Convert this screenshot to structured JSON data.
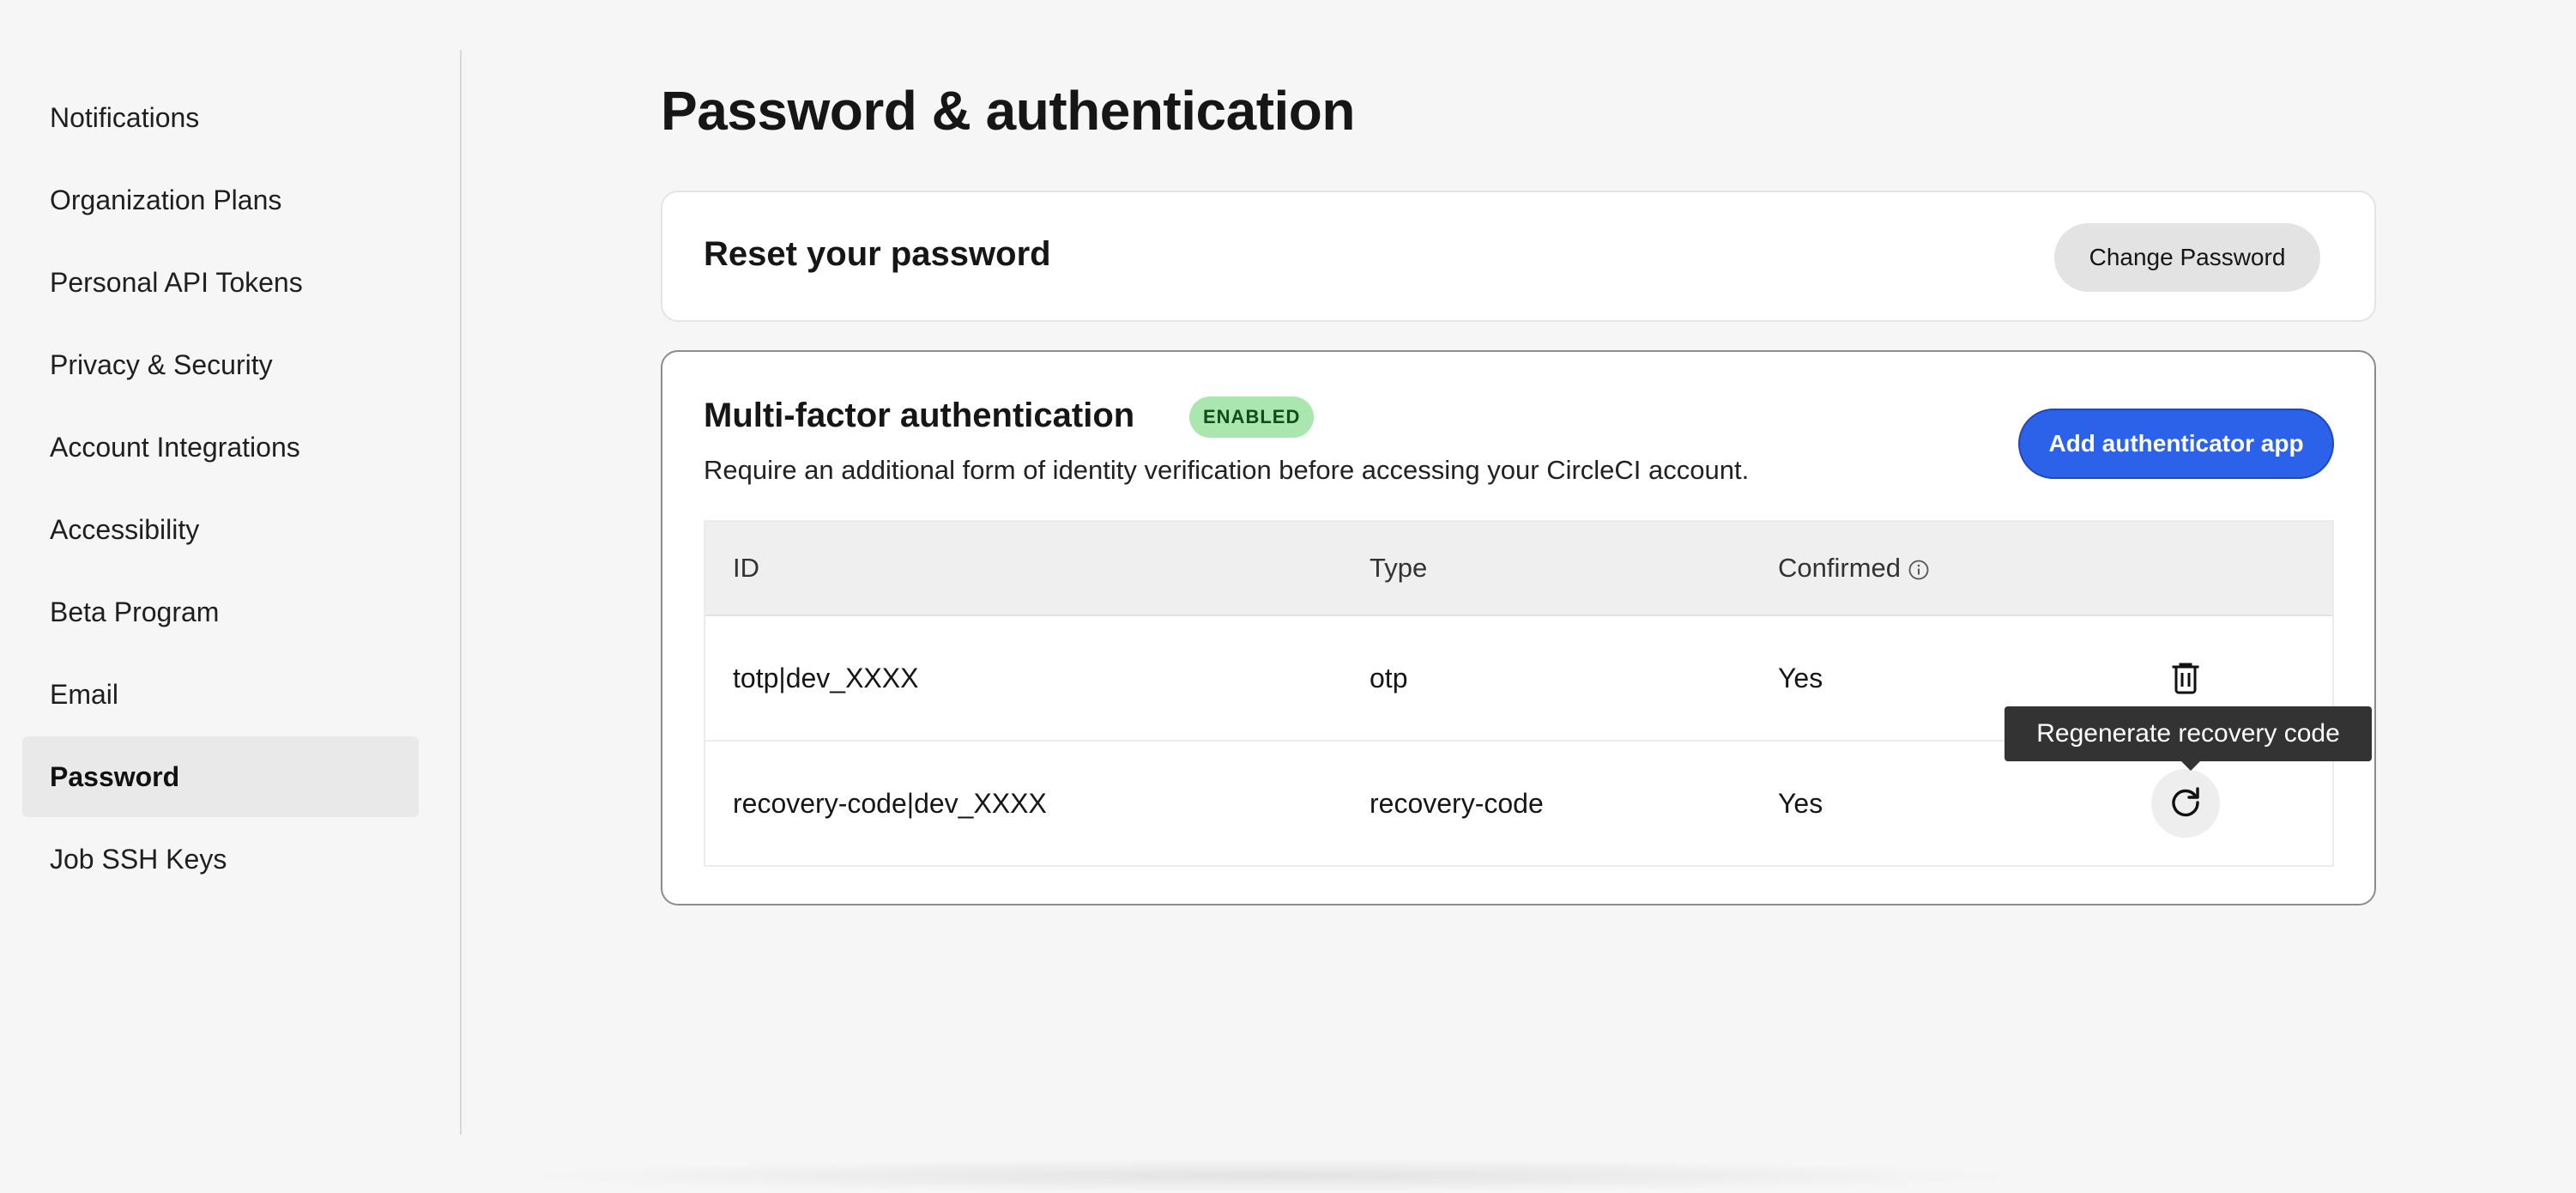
{
  "sidebar": {
    "items": [
      {
        "label": "Notifications",
        "active": false
      },
      {
        "label": "Organization Plans",
        "active": false
      },
      {
        "label": "Personal API Tokens",
        "active": false
      },
      {
        "label": "Privacy & Security",
        "active": false
      },
      {
        "label": "Account Integrations",
        "active": false
      },
      {
        "label": "Accessibility",
        "active": false
      },
      {
        "label": "Beta Program",
        "active": false
      },
      {
        "label": "Email",
        "active": false
      },
      {
        "label": "Password",
        "active": true
      },
      {
        "label": "Job SSH Keys",
        "active": false
      }
    ]
  },
  "main": {
    "title": "Password & authentication",
    "reset": {
      "title": "Reset your password",
      "button_label": "Change Password"
    },
    "mfa": {
      "title": "Multi-factor authentication",
      "badge": "ENABLED",
      "description": "Require an additional form of identity verification before accessing your CircleCI account.",
      "add_button_label": "Add authenticator app",
      "table": {
        "headers": {
          "id": "ID",
          "type": "Type",
          "confirmed": "Confirmed"
        },
        "rows": [
          {
            "id": "totp|dev_XXXX",
            "type": "otp",
            "confirmed": "Yes",
            "action_icon": "trash-icon"
          },
          {
            "id": "recovery-code|dev_XXXX",
            "type": "recovery-code",
            "confirmed": "Yes",
            "action_icon": "refresh-icon"
          }
        ]
      },
      "tooltip": "Regenerate recovery code"
    }
  },
  "colors": {
    "accent": "#2c61ea",
    "badge_bg": "#a9e7ae",
    "badge_text": "#114d19",
    "background": "#f6f6f6"
  }
}
